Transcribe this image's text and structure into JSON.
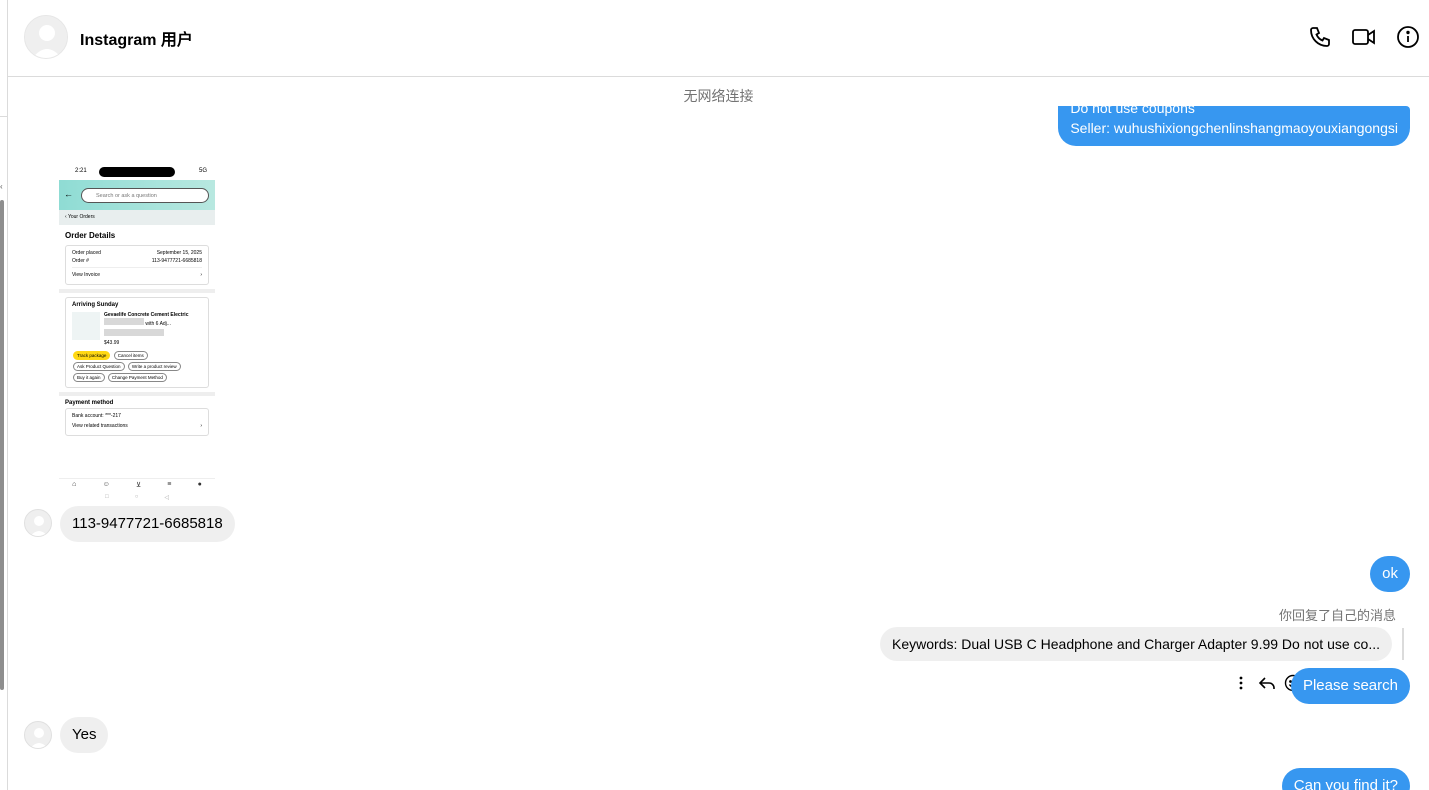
{
  "header": {
    "contact_name": "Instagram 用户",
    "icons": [
      "phone-icon",
      "video-camera-icon",
      "info-icon"
    ]
  },
  "chat": {
    "status": "无网络连接",
    "outgoing_top": {
      "line1": "Do not use coupons",
      "line2": "Seller: wuhushixiongchenlinshangmaoyouxiangongsi"
    },
    "screenshot": {
      "time": "2:21",
      "signal": "5G",
      "search_placeholder": "Search or ask a question",
      "breadcrumb": "‹ Your Orders",
      "title": "Order Details",
      "order_placed_label": "Order placed",
      "order_placed_value": "September 15, 2025",
      "order_num_label": "Order #",
      "order_num_value": "113-9477721-6685818",
      "view_invoice": "View Invoice",
      "arriving": "Arriving Sunday",
      "product_name": "Gevaelife Concrete Cement Electric",
      "product_name2": "with 6 Adj...",
      "price": "$43.99",
      "buttons": [
        "Track package",
        "Cancel items",
        "Ask Product Question",
        "Write a product review",
        "Buy it again",
        "Change Payment Method"
      ],
      "payment_title": "Payment method",
      "bank_account": "Bank account: ***-217",
      "view_transactions": "View related transactions"
    },
    "incoming_order_number": "113-9477721-6685818",
    "outgoing_ok": "ok",
    "reply_note": "你回复了自己的消息",
    "reply_quote": "Keywords: Dual USB C Headphone and Charger Adapter 9.99 Do not use co...",
    "outgoing_please_search": "Please search",
    "incoming_yes": "Yes",
    "outgoing_find": "Can you find it?"
  },
  "colors": {
    "outgoing_bubble": "#3797f0",
    "incoming_bubble": "#efefef",
    "muted_text": "#737373"
  }
}
